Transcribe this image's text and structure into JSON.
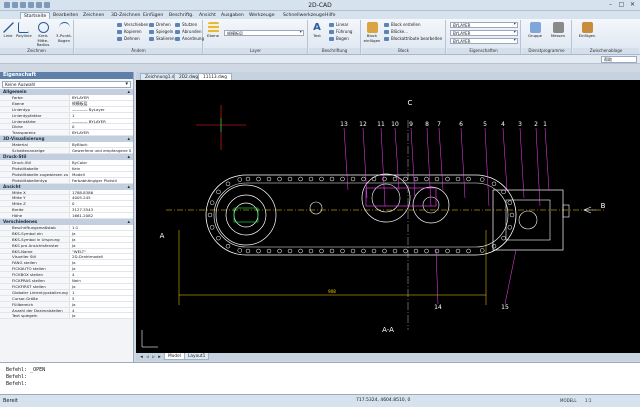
{
  "window": {
    "title": "2D-CAD"
  },
  "ribbon": {
    "tabs": [
      "Startseite",
      "Bearbeiten",
      "Zeichnen",
      "3D-Zeichnen",
      "Einfügen",
      "Beschriftg.",
      "Ansicht",
      "Ausgaben",
      "Werkzeuge",
      "Schnellwerkzeuge",
      "Hilfe"
    ],
    "active_tab": "Startseite",
    "groups": {
      "zeichnen": {
        "label": "Zeichnen",
        "tools": [
          "Linie",
          "Polylinie",
          "Kreis Mitte-Radius",
          "3-Punkt-Bogen"
        ]
      },
      "aendern": {
        "label": "Ändern",
        "tools": [
          "Verschieben",
          "Kopieren",
          "Dehnen",
          "Drehen",
          "Spiegeln",
          "Skalieren",
          "Stutzen",
          "Abrunden",
          "Anordnung"
        ]
      },
      "layer": {
        "label": "Layer",
        "tools": [
          "Ebene"
        ],
        "current_layer": "帧模板层"
      },
      "beschriftung": {
        "label": "Beschriftung",
        "tools": [
          "Text",
          "Linear",
          "Führung",
          "Bogen"
        ]
      },
      "block": {
        "label": "Block",
        "tools": [
          "Block einfügen",
          "Block erstellen",
          "Blöcke...",
          "Blockattribute bearbeiten"
        ]
      },
      "eigenschaften": {
        "label": "Eigenschaften",
        "color": "BYLAYER",
        "linetype": "BYLAYER",
        "lineweight": "BYLAYER"
      },
      "dienst": {
        "label": "Dienstprogramme",
        "tools": [
          "Gruppe",
          "Messen"
        ]
      },
      "zwischenablage": {
        "label": "Zwischenablage",
        "tools": [
          "Einfügen"
        ]
      }
    }
  },
  "search": {
    "placeholder": "帮助"
  },
  "document_tabs": [
    "Zeichnung1.dwg",
    "2D2.dwg",
    "11113.dwg"
  ],
  "active_document": "11113.dwg",
  "properties_panel": {
    "title": "Eigenschaft",
    "selection": "Keine Auswahl",
    "sections": [
      {
        "name": "Allgemein",
        "rows": [
          [
            "Farbe",
            "BYLAYER"
          ],
          [
            "Ebene",
            "帧模板层"
          ],
          [
            "Linientyp",
            "———— ByLayer"
          ],
          [
            "Linientypfaktor",
            "1"
          ],
          [
            "Linienstärke",
            "———— BYLAYER"
          ],
          [
            "Dicke",
            "0"
          ],
          [
            "Transparenz",
            "BYLAYER"
          ]
        ]
      },
      {
        "name": "3D-Visualisierung",
        "rows": [
          [
            "Material",
            "ByBlock"
          ],
          [
            "Schattenanzeige",
            "Gewerfene und empfangene S"
          ]
        ]
      },
      {
        "name": "Druck-Stil",
        "rows": [
          [
            "Druck-Stil",
            "ByColor"
          ],
          [
            "Plotstiltabelle",
            "Kein"
          ],
          [
            "Plotstiltabelle zugewiesen zu",
            "Modell"
          ],
          [
            "Plotstiltabellentyp",
            "Farbabhängiger Plotstil"
          ]
        ]
      },
      {
        "name": "Ansicht",
        "rows": [
          [
            "Mitte X",
            "1788.8386"
          ],
          [
            "Mitte Y",
            "4005.245"
          ],
          [
            "Mitte Z",
            "0"
          ],
          [
            "Breite",
            "3127.3543"
          ],
          [
            "Höhe",
            "1661.2082"
          ]
        ]
      },
      {
        "name": "Verschiedenes",
        "rows": [
          [
            "Beschriftungsmaßstab",
            "1:1"
          ],
          [
            "BKS-Symbol ein",
            "Ja"
          ],
          [
            "BKS-Symbol in Ursprung",
            "Ja"
          ],
          [
            "BKS pro Ansichtsfenster",
            "Ja"
          ],
          [
            "BKS-Name",
            "\"WELT\""
          ],
          [
            "Visueller Stil",
            "2D-Drahtmodell"
          ],
          [
            "FANG stellen",
            "Ja"
          ],
          [
            "FICKAUTO stellen",
            "Ja"
          ],
          [
            "FICKBOX stellen",
            "4"
          ],
          [
            "FICKPRAS stellen",
            "Nein"
          ],
          [
            "FICKFIRST stellen",
            "Ja"
          ],
          [
            "Globaler Linientypskalierung",
            "1"
          ],
          [
            "Cursor-Größe",
            "5"
          ],
          [
            "Füllbereich",
            "Ja"
          ],
          [
            "Anzahl der Dezimalstellen",
            "4"
          ],
          [
            "Text spiegeln",
            "Ja"
          ]
        ]
      }
    ]
  },
  "drawing": {
    "section_labels": {
      "a_left": "A",
      "a_right": "A",
      "b": "B",
      "c": "C",
      "section_aa": "A-A"
    },
    "balloons_top": [
      "13",
      "12",
      "11",
      "10",
      "9",
      "8",
      "7",
      "6",
      "5",
      "4",
      "3",
      "2",
      "1"
    ],
    "balloons_bottom": [
      "14",
      "15"
    ],
    "dimension_bottom": "908"
  },
  "layout_tabs": [
    "Model",
    "Layout1"
  ],
  "active_layout": "Model",
  "command_lines": [
    "Befehl:  _OPEN",
    "Befehl:",
    "Befehl:"
  ],
  "status": {
    "ready": "Bereit",
    "coordinates": "717.5324, 4604.8510, 0",
    "buttons": [
      "MODELL",
      "1:1"
    ]
  },
  "colors": {
    "canvas_bg": "#000000",
    "ribbon_bg": "#e8eef6",
    "line_white": "#ffffff",
    "line_magenta": "#ff40ff",
    "line_yellow": "#ffd600",
    "line_green": "#00ff40"
  }
}
